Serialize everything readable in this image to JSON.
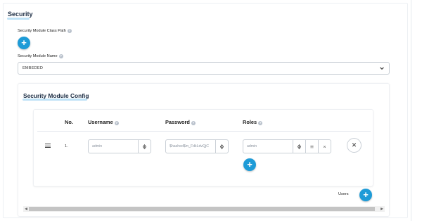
{
  "security": {
    "title": "Security",
    "class_path_label": "Security Module Class Path",
    "add_class_path_symbol": "+",
    "module_name_label": "Security Module Name",
    "module_name_value": "EMBEDED"
  },
  "config": {
    "title": "Security Module Config",
    "columns": {
      "no": "No.",
      "username": "Username",
      "password": "Password",
      "roles": "Roles"
    },
    "rows": [
      {
        "no": "1.",
        "username_placeholder": "admin",
        "password_value": "$hashed$m_FdkLdvQjC",
        "roles_value": "admin"
      }
    ],
    "add_role_symbol": "+",
    "remove_symbol": "✕",
    "users_label": "Users",
    "add_user_symbol": "+"
  },
  "icons": {
    "help": "help-circle-icon",
    "expression": "expression-icon",
    "list": "list-icon",
    "clear": "clear-icon",
    "chevron": "chevron-down-icon",
    "drag": "drag-handle-icon"
  },
  "colors": {
    "accent": "#1e9bd7",
    "title": "#1c2d44",
    "underline": "#bfe2f6"
  }
}
